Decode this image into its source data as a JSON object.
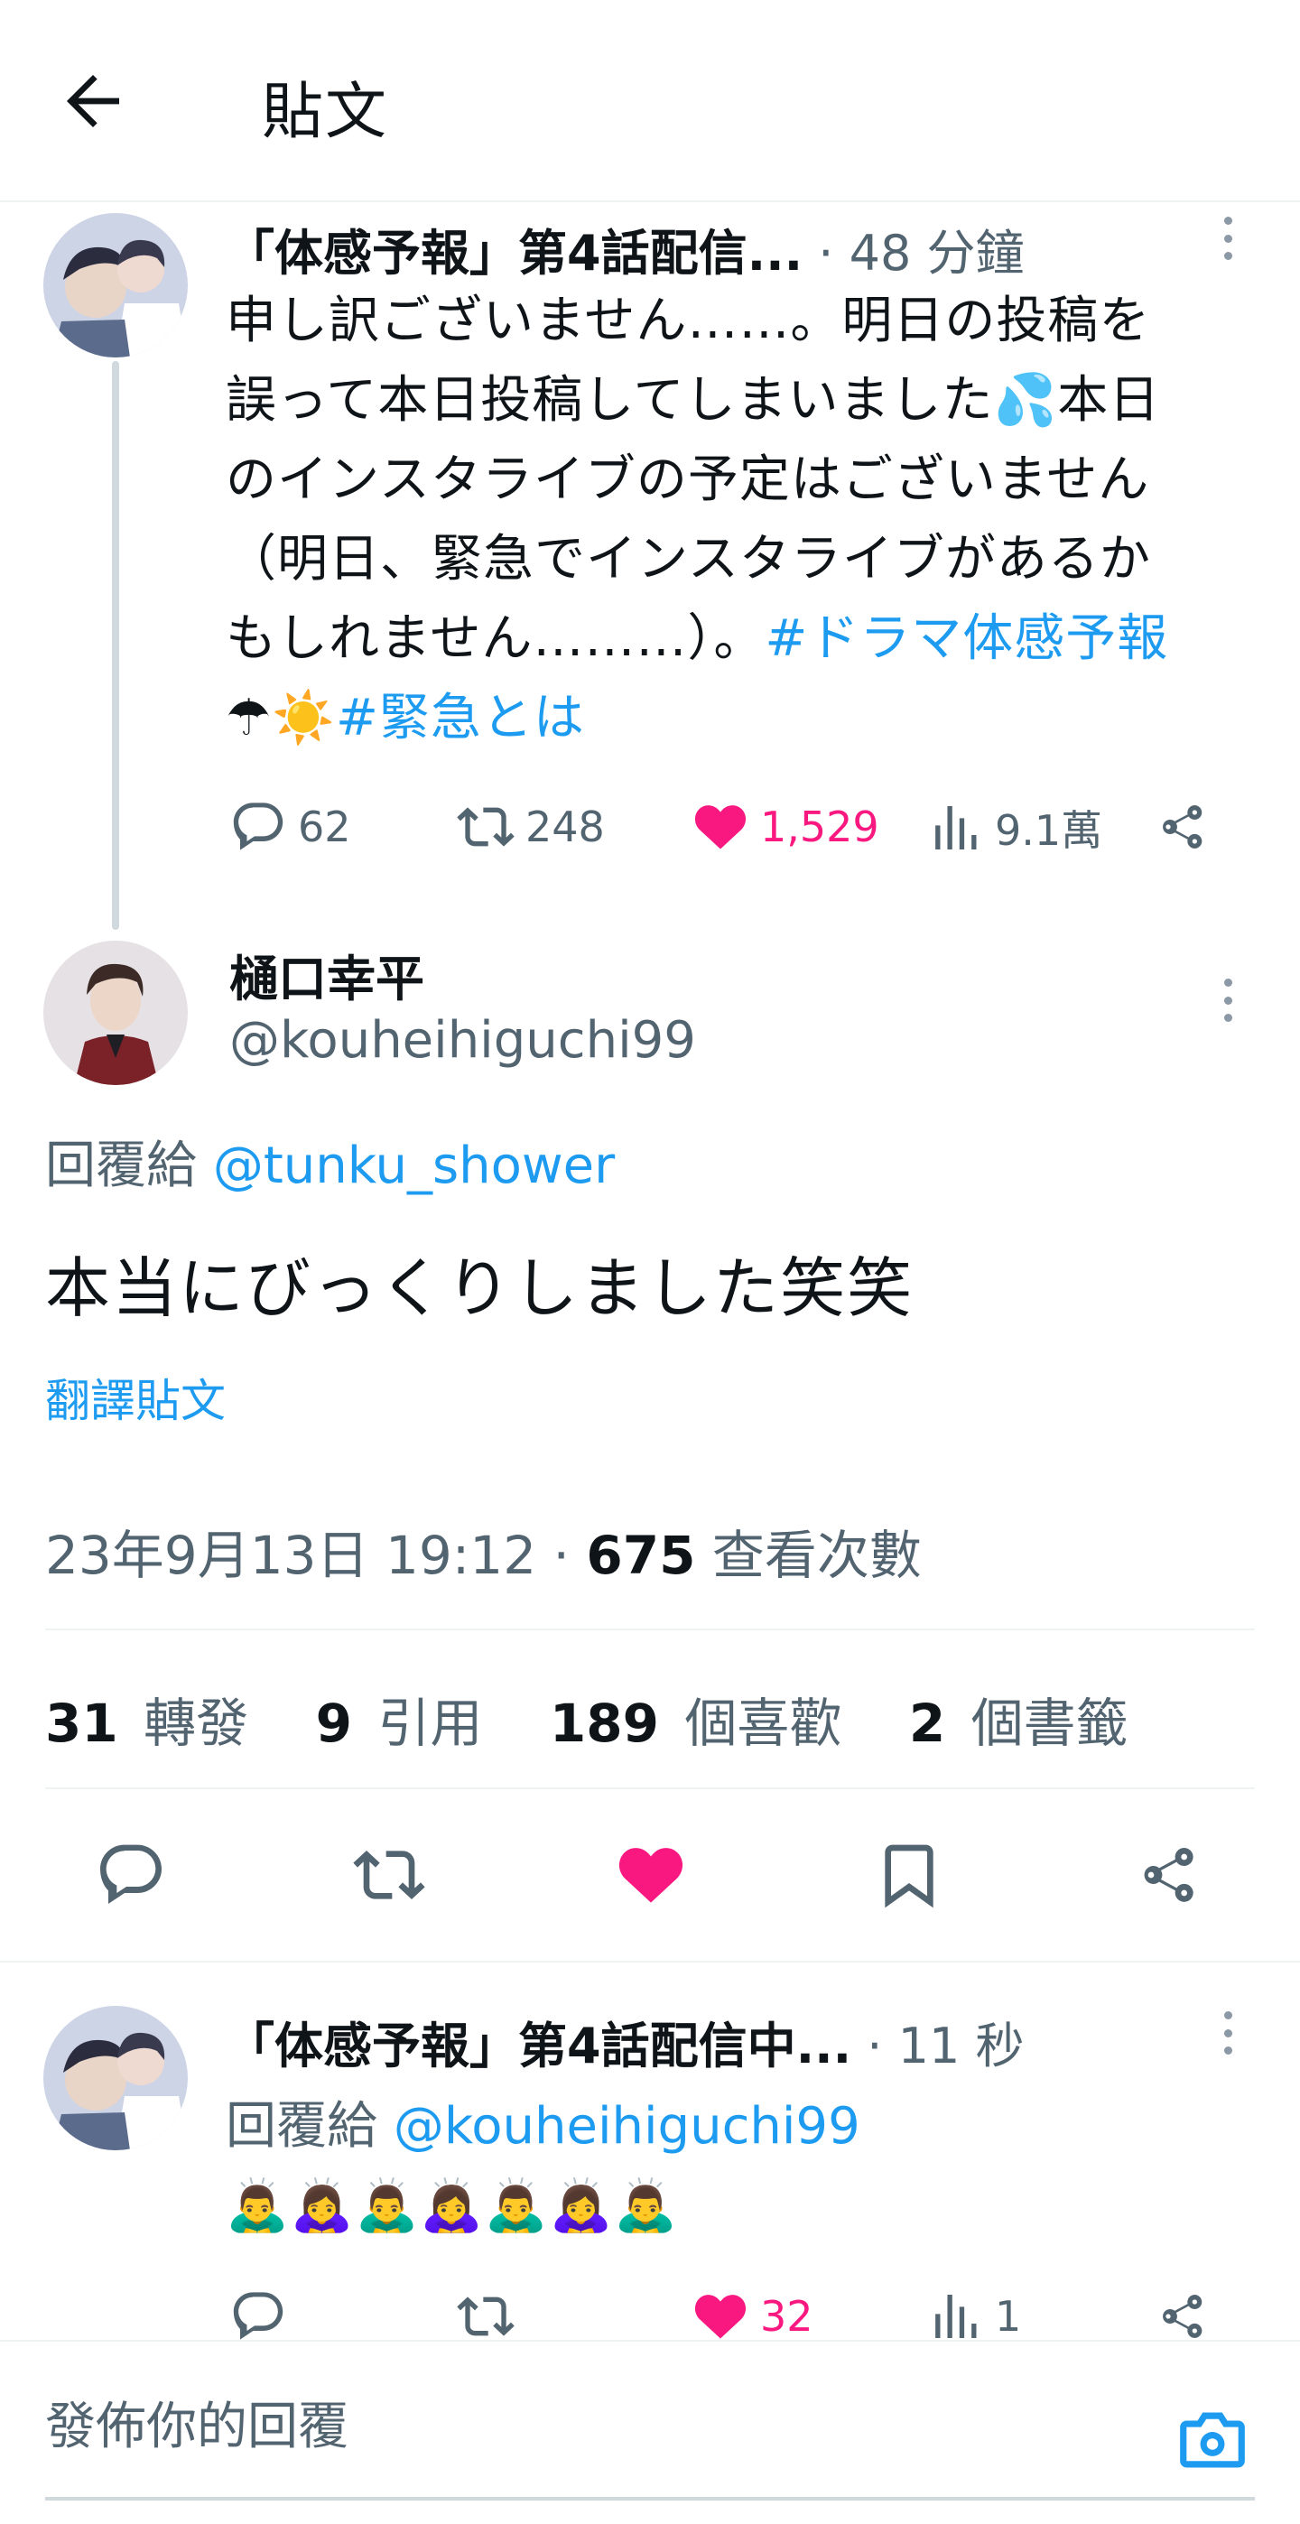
{
  "header": {
    "title": "貼文"
  },
  "parent_tweet": {
    "author": "「体感予報」第4話配信...",
    "time": "· 48 分鐘",
    "text_lines": [
      "申し訳ございません……。明日の投稿を",
      "誤って本日投稿してしまいました💦本日",
      "のインスタライブの予定はございません",
      "（明日、緊急でインスタライブがあるか"
    ],
    "line5_text": "もしれません………）。",
    "hashtag1": "#ドラマ体感予報",
    "line6_emoji": "☂☀️",
    "hashtag2": "#緊急とは",
    "replies": "62",
    "retweets": "248",
    "likes": "1,529",
    "views": "9.1萬"
  },
  "main_tweet": {
    "display_name": "樋口幸平",
    "handle": "@kouheihiguchi99",
    "reply_to_label": "回覆給",
    "reply_to_handle": "@tunku_shower",
    "text": "本当にびっくりしました笑笑",
    "translate": "翻譯貼文",
    "date": "23年9月13日 19:12",
    "dot": "·",
    "views_count": "675",
    "views_label": "查看次數",
    "stats": {
      "retweets_count": "31",
      "retweets_label": "轉發",
      "quotes_count": "9",
      "quotes_label": "引用",
      "likes_count": "189",
      "likes_label": "個喜歡",
      "bookmarks_count": "2",
      "bookmarks_label": "個書籤"
    }
  },
  "reply_tweet": {
    "author": "「体感予報」第4話配信中...",
    "time": "· 11 秒",
    "reply_to_label": "回覆給",
    "reply_to_handle": "@kouheihiguchi99",
    "text": "🙇‍♂️🙇‍♀️🙇‍♂️🙇‍♀️🙇‍♂️🙇‍♀️🙇‍♂️",
    "likes": "32",
    "views": "1"
  },
  "composer": {
    "placeholder": "發佈你的回覆"
  },
  "colors": {
    "accent": "#1d9bf0",
    "like": "#f91880",
    "muted": "#536471"
  }
}
